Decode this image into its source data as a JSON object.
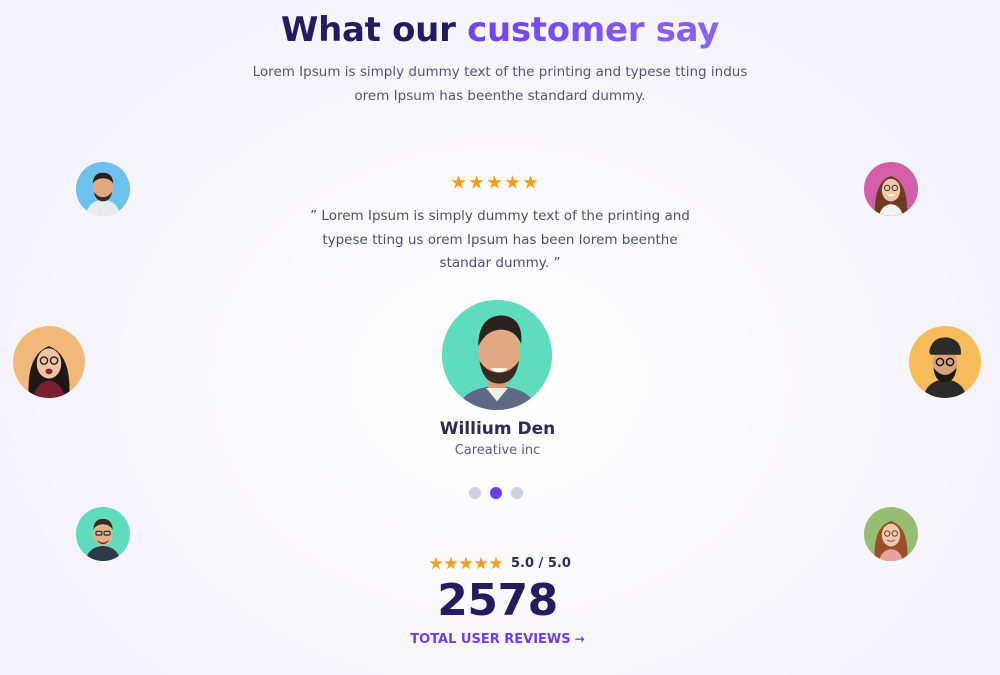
{
  "section": {
    "title_part1": "What our",
    "title_part2": "customer say",
    "subtitle": "Lorem Ipsum is simply dummy text of the printing and typese tting indus orem Ipsum has beenthe standard dummy."
  },
  "testimonial": {
    "rating_stars": 5,
    "quote": "” Lorem Ipsum is simply dummy text of the printing and typese tting us orem Ipsum has been lorem beenthe standar dummy. ”",
    "name": "Willium Den",
    "company": "Careative inc",
    "avatar_color": "#5edcbd"
  },
  "carousel": {
    "dot_count": 3,
    "active_index": 1
  },
  "summary": {
    "rating": "5.0 / 5.0",
    "count": "2578",
    "link_label": "TOTAL USER REVIEWS",
    "link_arrow": "→"
  },
  "colors": {
    "title_dark": "#241c5e",
    "accent": "#6b3ff0",
    "star": "#f79c16"
  }
}
